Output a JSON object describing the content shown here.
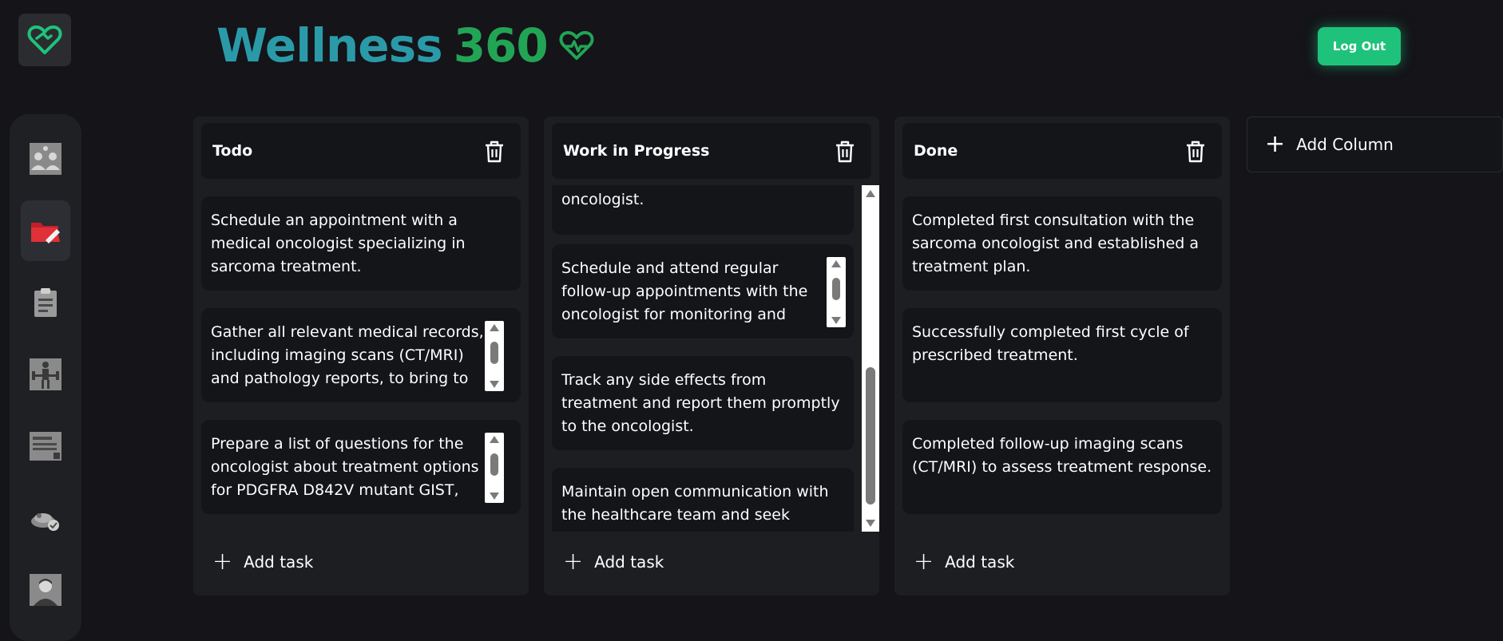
{
  "app": {
    "title_part1": "Wellness",
    "title_part2": "360"
  },
  "header": {
    "logout_label": "Log Out"
  },
  "colors": {
    "accent_green": "#1fc27a",
    "title_teal": "#2a9aa8",
    "title_green": "#22a455",
    "background": "#141419"
  },
  "sidebar": {
    "items": [
      {
        "icon": "team-icon",
        "active": false
      },
      {
        "icon": "medical-folder-icon",
        "active": true
      },
      {
        "icon": "clipboard-icon",
        "active": false
      },
      {
        "icon": "fitness-icon",
        "active": false
      },
      {
        "icon": "id-card-icon",
        "active": false
      },
      {
        "icon": "food-icon",
        "active": false
      },
      {
        "icon": "profile-icon",
        "active": false
      }
    ]
  },
  "board": {
    "add_task_label": "Add task",
    "add_column_label": "Add Column",
    "columns": [
      {
        "title": "Todo",
        "cards": [
          "Schedule an appointment with a medical oncologist specializing in sarcoma treatment.",
          "Gather all relevant medical records, including imaging scans (CT/MRI) and pathology reports, to bring to",
          "Prepare a list of questions for the oncologist about treatment options for PDGFRA D842V mutant GIST,"
        ]
      },
      {
        "title": "Work in Progress",
        "cards": [
          "oncologist.",
          "Schedule and attend regular follow-up appointments with the oncologist for monitoring and",
          "Track any side effects from treatment and report them promptly to the oncologist.",
          "Maintain open communication with the healthcare team and seek emotional support if needed."
        ]
      },
      {
        "title": "Done",
        "cards": [
          "Completed first consultation with the sarcoma oncologist and established a treatment plan.",
          "Successfully completed first cycle of prescribed treatment.",
          "Completed follow-up imaging scans (CT/MRI) to assess treatment response."
        ]
      }
    ]
  }
}
